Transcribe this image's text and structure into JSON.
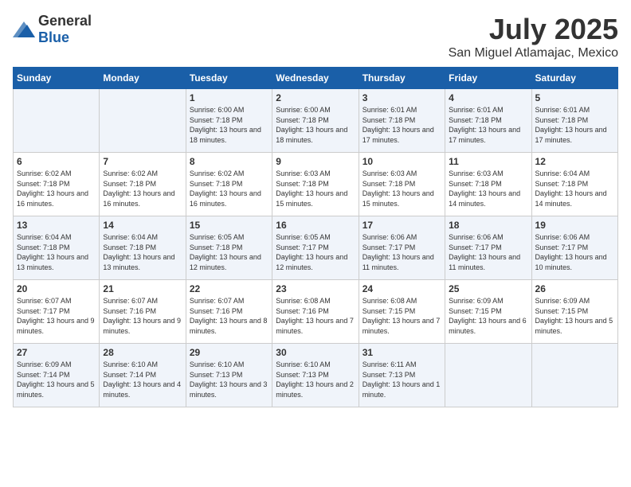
{
  "logo": {
    "general": "General",
    "blue": "Blue"
  },
  "title": "July 2025",
  "subtitle": "San Miguel Atlamajac, Mexico",
  "headers": [
    "Sunday",
    "Monday",
    "Tuesday",
    "Wednesday",
    "Thursday",
    "Friday",
    "Saturday"
  ],
  "weeks": [
    [
      {
        "day": "",
        "detail": ""
      },
      {
        "day": "",
        "detail": ""
      },
      {
        "day": "1",
        "detail": "Sunrise: 6:00 AM\nSunset: 7:18 PM\nDaylight: 13 hours\nand 18 minutes."
      },
      {
        "day": "2",
        "detail": "Sunrise: 6:00 AM\nSunset: 7:18 PM\nDaylight: 13 hours\nand 18 minutes."
      },
      {
        "day": "3",
        "detail": "Sunrise: 6:01 AM\nSunset: 7:18 PM\nDaylight: 13 hours\nand 17 minutes."
      },
      {
        "day": "4",
        "detail": "Sunrise: 6:01 AM\nSunset: 7:18 PM\nDaylight: 13 hours\nand 17 minutes."
      },
      {
        "day": "5",
        "detail": "Sunrise: 6:01 AM\nSunset: 7:18 PM\nDaylight: 13 hours\nand 17 minutes."
      }
    ],
    [
      {
        "day": "6",
        "detail": "Sunrise: 6:02 AM\nSunset: 7:18 PM\nDaylight: 13 hours\nand 16 minutes."
      },
      {
        "day": "7",
        "detail": "Sunrise: 6:02 AM\nSunset: 7:18 PM\nDaylight: 13 hours\nand 16 minutes."
      },
      {
        "day": "8",
        "detail": "Sunrise: 6:02 AM\nSunset: 7:18 PM\nDaylight: 13 hours\nand 16 minutes."
      },
      {
        "day": "9",
        "detail": "Sunrise: 6:03 AM\nSunset: 7:18 PM\nDaylight: 13 hours\nand 15 minutes."
      },
      {
        "day": "10",
        "detail": "Sunrise: 6:03 AM\nSunset: 7:18 PM\nDaylight: 13 hours\nand 15 minutes."
      },
      {
        "day": "11",
        "detail": "Sunrise: 6:03 AM\nSunset: 7:18 PM\nDaylight: 13 hours\nand 14 minutes."
      },
      {
        "day": "12",
        "detail": "Sunrise: 6:04 AM\nSunset: 7:18 PM\nDaylight: 13 hours\nand 14 minutes."
      }
    ],
    [
      {
        "day": "13",
        "detail": "Sunrise: 6:04 AM\nSunset: 7:18 PM\nDaylight: 13 hours\nand 13 minutes."
      },
      {
        "day": "14",
        "detail": "Sunrise: 6:04 AM\nSunset: 7:18 PM\nDaylight: 13 hours\nand 13 minutes."
      },
      {
        "day": "15",
        "detail": "Sunrise: 6:05 AM\nSunset: 7:18 PM\nDaylight: 13 hours\nand 12 minutes."
      },
      {
        "day": "16",
        "detail": "Sunrise: 6:05 AM\nSunset: 7:17 PM\nDaylight: 13 hours\nand 12 minutes."
      },
      {
        "day": "17",
        "detail": "Sunrise: 6:06 AM\nSunset: 7:17 PM\nDaylight: 13 hours\nand 11 minutes."
      },
      {
        "day": "18",
        "detail": "Sunrise: 6:06 AM\nSunset: 7:17 PM\nDaylight: 13 hours\nand 11 minutes."
      },
      {
        "day": "19",
        "detail": "Sunrise: 6:06 AM\nSunset: 7:17 PM\nDaylight: 13 hours\nand 10 minutes."
      }
    ],
    [
      {
        "day": "20",
        "detail": "Sunrise: 6:07 AM\nSunset: 7:17 PM\nDaylight: 13 hours\nand 9 minutes."
      },
      {
        "day": "21",
        "detail": "Sunrise: 6:07 AM\nSunset: 7:16 PM\nDaylight: 13 hours\nand 9 minutes."
      },
      {
        "day": "22",
        "detail": "Sunrise: 6:07 AM\nSunset: 7:16 PM\nDaylight: 13 hours\nand 8 minutes."
      },
      {
        "day": "23",
        "detail": "Sunrise: 6:08 AM\nSunset: 7:16 PM\nDaylight: 13 hours\nand 7 minutes."
      },
      {
        "day": "24",
        "detail": "Sunrise: 6:08 AM\nSunset: 7:15 PM\nDaylight: 13 hours\nand 7 minutes."
      },
      {
        "day": "25",
        "detail": "Sunrise: 6:09 AM\nSunset: 7:15 PM\nDaylight: 13 hours\nand 6 minutes."
      },
      {
        "day": "26",
        "detail": "Sunrise: 6:09 AM\nSunset: 7:15 PM\nDaylight: 13 hours\nand 5 minutes."
      }
    ],
    [
      {
        "day": "27",
        "detail": "Sunrise: 6:09 AM\nSunset: 7:14 PM\nDaylight: 13 hours\nand 5 minutes."
      },
      {
        "day": "28",
        "detail": "Sunrise: 6:10 AM\nSunset: 7:14 PM\nDaylight: 13 hours\nand 4 minutes."
      },
      {
        "day": "29",
        "detail": "Sunrise: 6:10 AM\nSunset: 7:13 PM\nDaylight: 13 hours\nand 3 minutes."
      },
      {
        "day": "30",
        "detail": "Sunrise: 6:10 AM\nSunset: 7:13 PM\nDaylight: 13 hours\nand 2 minutes."
      },
      {
        "day": "31",
        "detail": "Sunrise: 6:11 AM\nSunset: 7:13 PM\nDaylight: 13 hours\nand 1 minute."
      },
      {
        "day": "",
        "detail": ""
      },
      {
        "day": "",
        "detail": ""
      }
    ]
  ]
}
